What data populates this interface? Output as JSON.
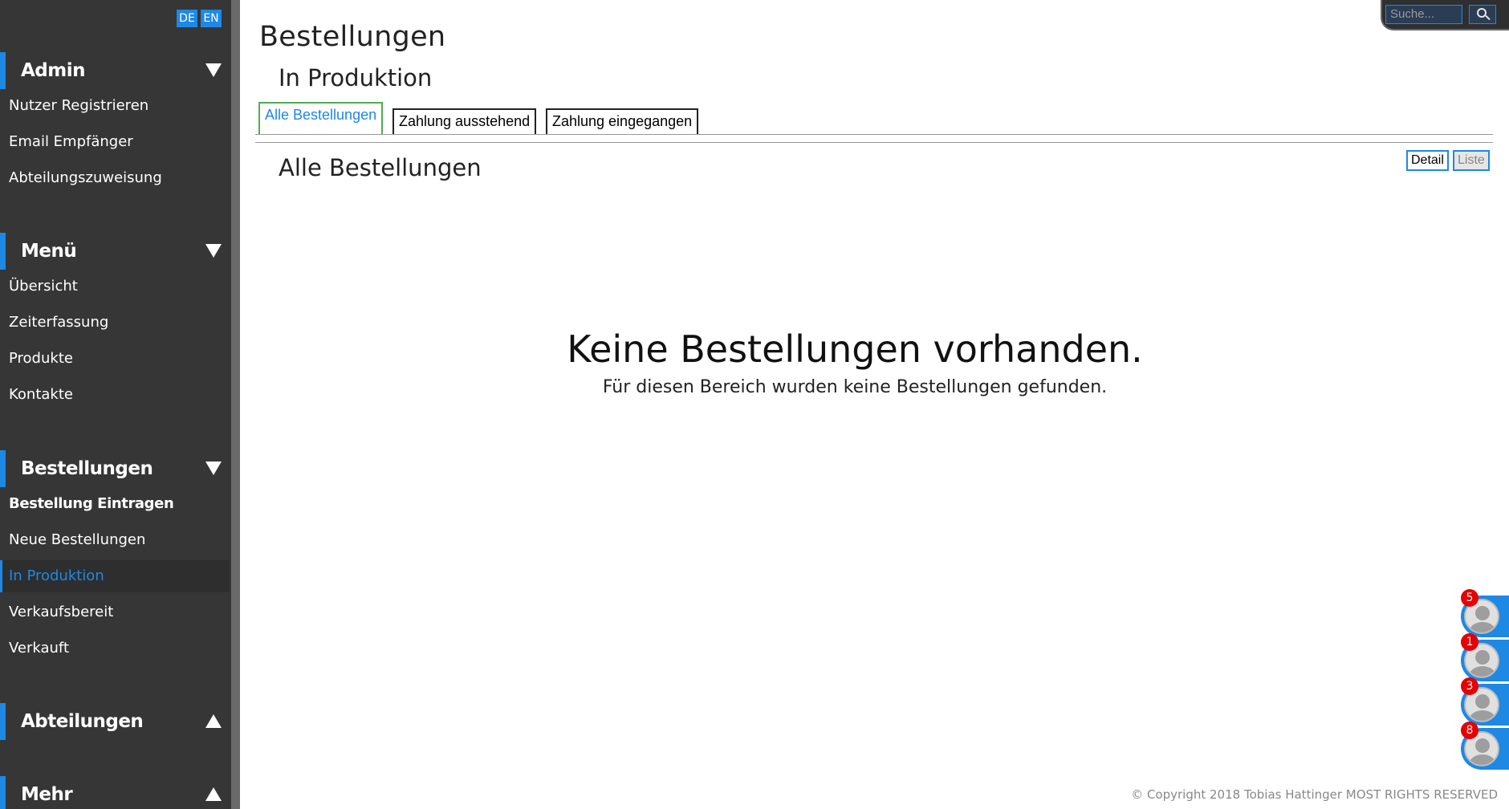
{
  "language": {
    "de": "DE",
    "en": "EN"
  },
  "sidebar": {
    "sections": [
      {
        "label": "Admin",
        "items": [
          "Nutzer Registrieren",
          "Email Empfänger",
          "Abteilungszuweisung"
        ]
      },
      {
        "label": "Menü",
        "items": [
          "Übersicht",
          "Zeiterfassung",
          "Produkte",
          "Kontakte"
        ]
      },
      {
        "label": "Bestellungen",
        "items": [
          "Bestellung Eintragen",
          "Neue Bestellungen",
          "In Produktion",
          "Verkaufsbereit",
          "Verkauft"
        ]
      },
      {
        "label": "Abteilungen"
      },
      {
        "label": "Mehr"
      }
    ]
  },
  "main": {
    "title": "Bestellungen",
    "subtitle": "In Produktion",
    "tabs": [
      "Alle Bestellungen",
      "Zahlung ausstehend",
      "Zahlung eingegangen"
    ],
    "section_title": "Alle Bestellungen",
    "view_detail": "Detail",
    "view_list": "Liste",
    "empty_title": "Keine Bestellungen vorhanden.",
    "empty_subtitle": "Für diesen Bereich wurden keine Bestellungen gefunden."
  },
  "search": {
    "placeholder": "Suche..."
  },
  "chat": {
    "badges": [
      "5",
      "1",
      "3",
      "8"
    ]
  },
  "footer": "© Copyright 2018 Tobias Hattinger MOST RIGHTS RESERVED",
  "colors": {
    "accent": "#1e88e5",
    "sidebar": "#363636",
    "badge": "#e60000",
    "active_tab_border": "#4caf50"
  }
}
